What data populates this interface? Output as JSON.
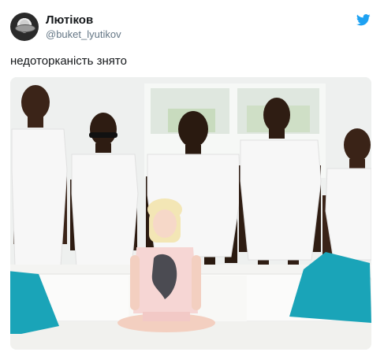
{
  "tweet": {
    "display_name": "Лютіков",
    "username": "@buket_lyutikov",
    "text": "недоторканість знято"
  },
  "icons": {
    "avatar": "avatar-image",
    "bird": "twitter-bird-icon"
  },
  "colors": {
    "twitter_blue": "#1da1f2",
    "secondary_text": "#657786",
    "pillow": "#1aa4b8"
  }
}
